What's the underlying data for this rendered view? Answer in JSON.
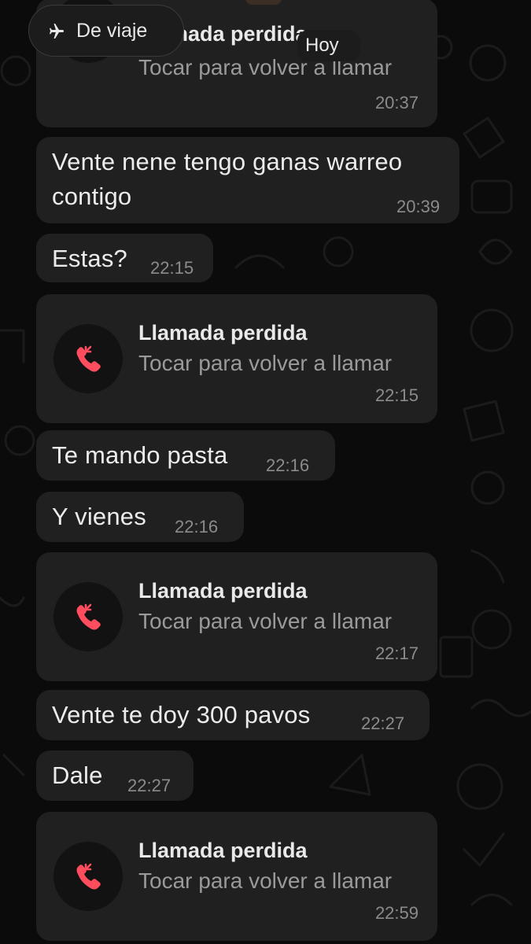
{
  "status_chip": {
    "label": "De viaje",
    "icon": "airplane-icon"
  },
  "date_chip": {
    "label": "Hoy"
  },
  "colors": {
    "background": "#0b0b0b",
    "bubble": "#202020",
    "missed_call": "#ff4d5e",
    "time": "#8b8b8b"
  },
  "messages": [
    {
      "type": "call",
      "title": "Llamada perdida",
      "subtitle": "Tocar para volver a llamar",
      "time": "20:37"
    },
    {
      "type": "text",
      "lines": [
        "Vente nene tengo ganas warreo",
        "contigo"
      ],
      "time": "20:39"
    },
    {
      "type": "text",
      "lines": [
        "Estas?"
      ],
      "time": "22:15"
    },
    {
      "type": "call",
      "title": "Llamada perdida",
      "subtitle": "Tocar para volver a llamar",
      "time": "22:15"
    },
    {
      "type": "text",
      "lines": [
        "Te mando pasta"
      ],
      "time": "22:16"
    },
    {
      "type": "text",
      "lines": [
        "Y vienes"
      ],
      "time": "22:16"
    },
    {
      "type": "call",
      "title": "Llamada perdida",
      "subtitle": "Tocar para volver a llamar",
      "time": "22:17"
    },
    {
      "type": "text",
      "lines": [
        "Vente te doy 300 pavos"
      ],
      "time": "22:27"
    },
    {
      "type": "text",
      "lines": [
        "Dale"
      ],
      "time": "22:27"
    },
    {
      "type": "call",
      "title": "Llamada perdida",
      "subtitle": "Tocar para volver a llamar",
      "time": "22:59"
    }
  ]
}
